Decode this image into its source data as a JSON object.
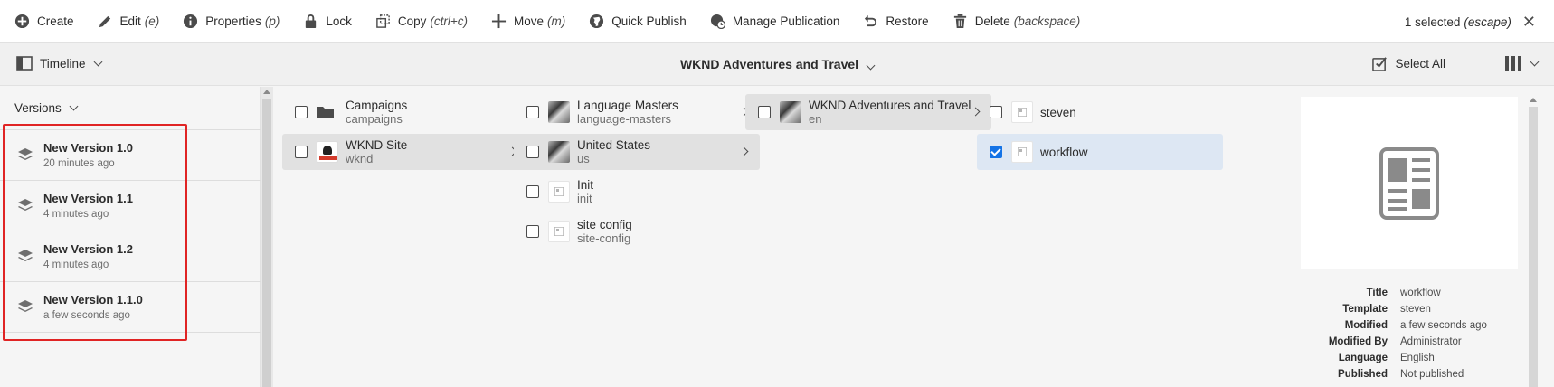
{
  "toolbar": {
    "create": {
      "label": "Create",
      "icon": "plus-circle-icon"
    },
    "edit": {
      "label": "Edit",
      "shortcut": "(e)",
      "icon": "pencil-icon"
    },
    "properties": {
      "label": "Properties",
      "shortcut": "(p)",
      "icon": "info-icon"
    },
    "lock": {
      "label": "Lock",
      "icon": "lock-icon"
    },
    "copy": {
      "label": "Copy",
      "shortcut": "(ctrl+c)",
      "icon": "copy-icon"
    },
    "move": {
      "label": "Move",
      "shortcut": "(m)",
      "icon": "move-icon"
    },
    "quick_publish": {
      "label": "Quick Publish",
      "icon": "globe-icon"
    },
    "manage_publication": {
      "label": "Manage Publication",
      "icon": "globe-clock-icon"
    },
    "restore": {
      "label": "Restore",
      "icon": "undo-icon"
    },
    "delete": {
      "label": "Delete",
      "shortcut": "(backspace)",
      "icon": "trash-icon"
    },
    "selection": {
      "label": "1 selected",
      "shortcut": "(escape)"
    }
  },
  "subbar": {
    "rail_label": "Timeline",
    "title": "WKND Adventures and Travel",
    "select_all": "Select All"
  },
  "rail": {
    "header": "Versions",
    "versions": [
      {
        "title": "New Version 1.0",
        "time": "20 minutes ago"
      },
      {
        "title": "New Version 1.1",
        "time": "4 minutes ago"
      },
      {
        "title": "New Version 1.2",
        "time": "4 minutes ago"
      },
      {
        "title": "New Version 1.1.0",
        "time": "a few seconds ago"
      }
    ]
  },
  "columns": {
    "col1": [
      {
        "title": "Campaigns",
        "sub": "campaigns"
      },
      {
        "title": "WKND Site",
        "sub": "wknd"
      }
    ],
    "col2": [
      {
        "title": "Language Masters",
        "sub": "language-masters"
      },
      {
        "title": "United States",
        "sub": "us"
      },
      {
        "title": "Init",
        "sub": "init"
      },
      {
        "title": "site config",
        "sub": "site-config"
      }
    ],
    "col3": [
      {
        "title": "WKND Adventures and Travel",
        "sub": "en"
      }
    ],
    "col4": [
      {
        "title": "steven"
      },
      {
        "title": "workflow"
      }
    ]
  },
  "meta": {
    "title": {
      "k": "Title",
      "v": "workflow"
    },
    "template": {
      "k": "Template",
      "v": "steven"
    },
    "modified": {
      "k": "Modified",
      "v": "a few seconds ago"
    },
    "modified_by": {
      "k": "Modified By",
      "v": "Administrator"
    },
    "language": {
      "k": "Language",
      "v": "English"
    },
    "published": {
      "k": "Published",
      "v": "Not published"
    }
  },
  "colors": {
    "accent": "#1473e6",
    "highlight": "#e02424"
  }
}
